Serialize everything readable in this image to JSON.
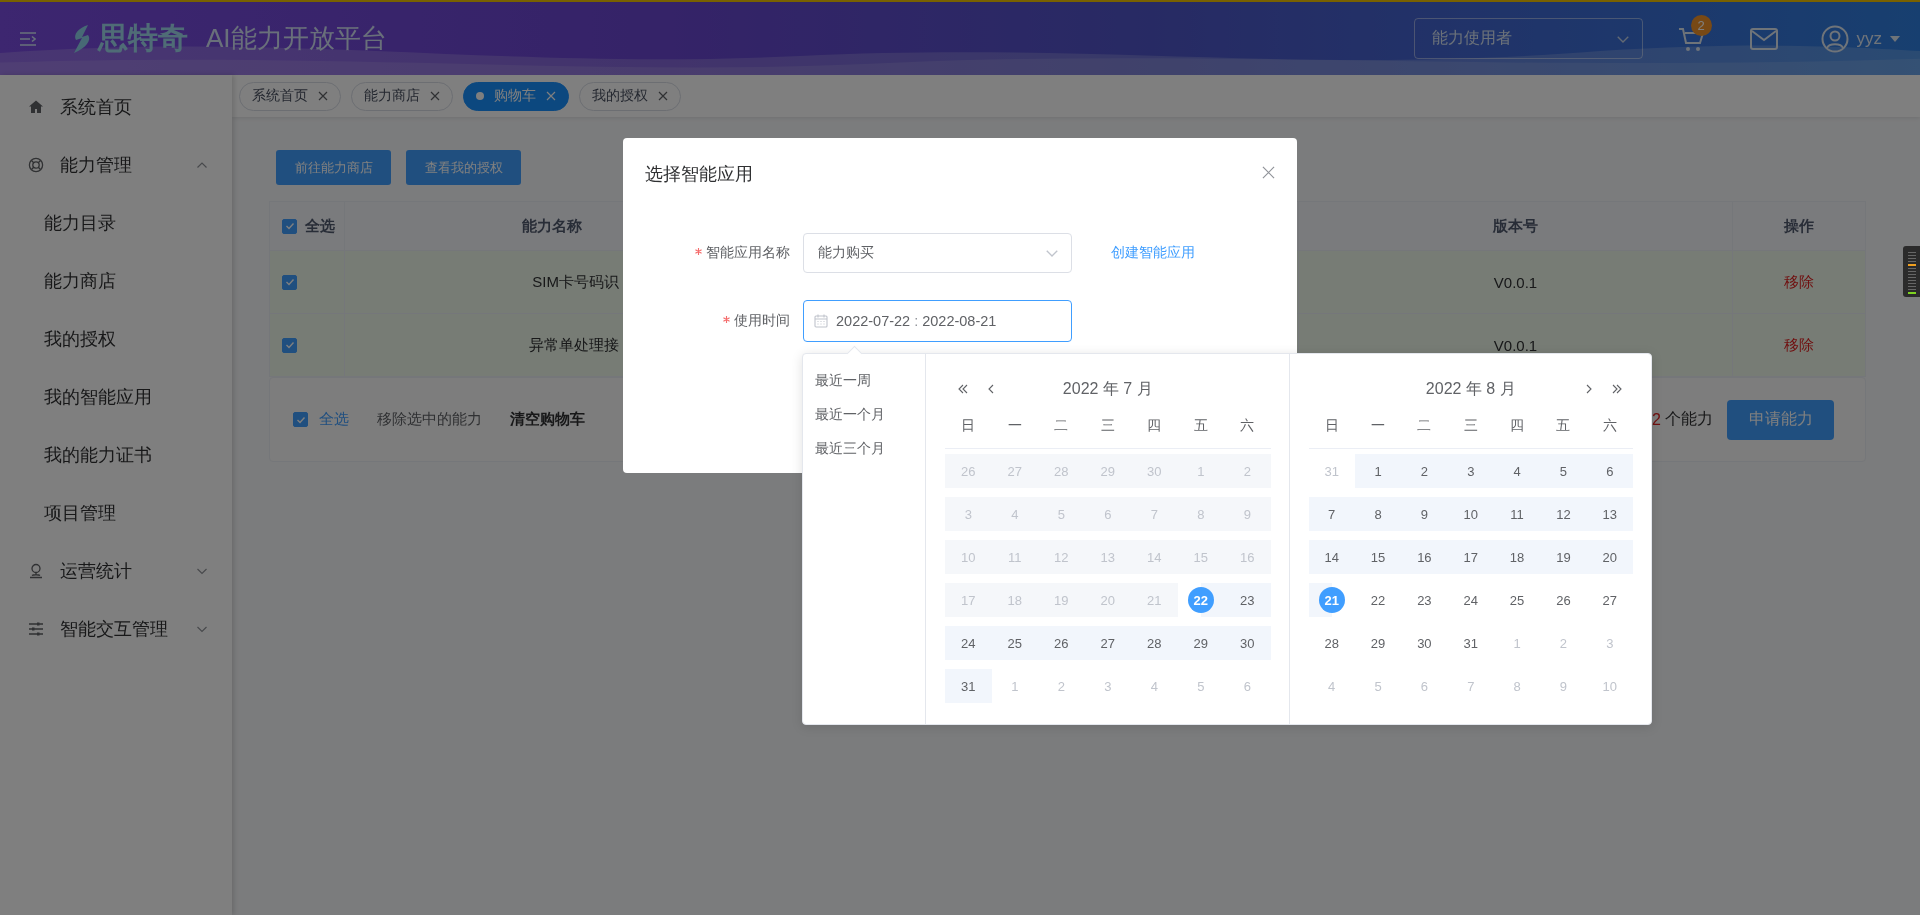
{
  "header": {
    "brand": "思特奇",
    "title": "AI能力开放平台",
    "role_select": "能力使用者",
    "cart_count": "2",
    "user": "yyz"
  },
  "sidebar": {
    "items": [
      {
        "label": "系统首页"
      },
      {
        "label": "能力管理",
        "expanded": true,
        "children": [
          {
            "label": "能力目录"
          },
          {
            "label": "能力商店"
          },
          {
            "label": "我的授权"
          },
          {
            "label": "我的智能应用"
          },
          {
            "label": "我的能力证书"
          },
          {
            "label": "项目管理"
          }
        ]
      },
      {
        "label": "运营统计",
        "expanded": false
      },
      {
        "label": "智能交互管理",
        "expanded": false
      }
    ]
  },
  "tabs": [
    {
      "label": "系统首页",
      "selected": false
    },
    {
      "label": "能力商店",
      "selected": false
    },
    {
      "label": "购物车",
      "selected": true
    },
    {
      "label": "我的授权",
      "selected": false
    }
  ],
  "toolbar_buttons": [
    "前往能力商店",
    "查看我的授权"
  ],
  "table": {
    "select_all": {
      "label": "全选",
      "checked": true
    },
    "columns": [
      "能力名称",
      "版本号",
      "操作"
    ],
    "rows": [
      {
        "checked": true,
        "name": "SIM卡号码识",
        "version": "V0.0.1",
        "action": "移除"
      },
      {
        "checked": true,
        "name": "异常单处理接",
        "version": "V0.0.1",
        "action": "移除"
      }
    ]
  },
  "footer": {
    "select_all": {
      "label": "全选",
      "checked": true
    },
    "remove_selected": "移除选中的能力",
    "clear_cart": "清空购物车",
    "count": "2",
    "count_label": "个能力",
    "apply_button": "申请能力"
  },
  "dialog": {
    "title": "选择智能应用",
    "fields": [
      {
        "kind": "select",
        "label": "智能应用名称",
        "required": true,
        "value": "能力购买",
        "link": "创建智能应用"
      },
      {
        "kind": "daterange",
        "label": "使用时间",
        "required": true,
        "focused": true,
        "start": "2022-07-22",
        "separator": ":",
        "end": "2022-08-21"
      }
    ]
  },
  "date_picker": {
    "shortcuts": [
      "最近一周",
      "最近一个月",
      "最近三个月"
    ],
    "panels": [
      {
        "title": "2022 年 7 月",
        "weekdays": [
          "日",
          "一",
          "二",
          "三",
          "四",
          "五",
          "六"
        ],
        "weeks": [
          [
            {
              "d": "26",
              "kind": "disabled"
            },
            {
              "d": "27",
              "kind": "disabled"
            },
            {
              "d": "28",
              "kind": "disabled"
            },
            {
              "d": "29",
              "kind": "disabled"
            },
            {
              "d": "30",
              "kind": "disabled"
            },
            {
              "d": "1",
              "kind": "disabled"
            },
            {
              "d": "2",
              "kind": "disabled"
            }
          ],
          [
            {
              "d": "3",
              "kind": "disabled"
            },
            {
              "d": "4",
              "kind": "disabled"
            },
            {
              "d": "5",
              "kind": "disabled"
            },
            {
              "d": "6",
              "kind": "disabled"
            },
            {
              "d": "7",
              "kind": "disabled"
            },
            {
              "d": "8",
              "kind": "disabled"
            },
            {
              "d": "9",
              "kind": "disabled"
            }
          ],
          [
            {
              "d": "10",
              "kind": "disabled"
            },
            {
              "d": "11",
              "kind": "disabled"
            },
            {
              "d": "12",
              "kind": "disabled"
            },
            {
              "d": "13",
              "kind": "disabled"
            },
            {
              "d": "14",
              "kind": "disabled"
            },
            {
              "d": "15",
              "kind": "disabled"
            },
            {
              "d": "16",
              "kind": "disabled"
            }
          ],
          [
            {
              "d": "17",
              "kind": "disabled"
            },
            {
              "d": "18",
              "kind": "disabled"
            },
            {
              "d": "19",
              "kind": "disabled"
            },
            {
              "d": "20",
              "kind": "disabled"
            },
            {
              "d": "21",
              "kind": "disabled"
            },
            {
              "d": "22",
              "kind": "start"
            },
            {
              "d": "23",
              "kind": "range"
            }
          ],
          [
            {
              "d": "24",
              "kind": "range"
            },
            {
              "d": "25",
              "kind": "range"
            },
            {
              "d": "26",
              "kind": "range"
            },
            {
              "d": "27",
              "kind": "range"
            },
            {
              "d": "28",
              "kind": "range"
            },
            {
              "d": "29",
              "kind": "range"
            },
            {
              "d": "30",
              "kind": "range"
            }
          ],
          [
            {
              "d": "31",
              "kind": "range"
            },
            {
              "d": "1",
              "kind": "outside"
            },
            {
              "d": "2",
              "kind": "outside"
            },
            {
              "d": "3",
              "kind": "outside"
            },
            {
              "d": "4",
              "kind": "outside"
            },
            {
              "d": "5",
              "kind": "outside"
            },
            {
              "d": "6",
              "kind": "outside"
            }
          ]
        ]
      },
      {
        "title": "2022 年 8 月",
        "weekdays": [
          "日",
          "一",
          "二",
          "三",
          "四",
          "五",
          "六"
        ],
        "weeks": [
          [
            {
              "d": "31",
              "kind": "outside"
            },
            {
              "d": "1",
              "kind": "range"
            },
            {
              "d": "2",
              "kind": "range"
            },
            {
              "d": "3",
              "kind": "range"
            },
            {
              "d": "4",
              "kind": "range"
            },
            {
              "d": "5",
              "kind": "range"
            },
            {
              "d": "6",
              "kind": "range"
            }
          ],
          [
            {
              "d": "7",
              "kind": "range"
            },
            {
              "d": "8",
              "kind": "range"
            },
            {
              "d": "9",
              "kind": "range"
            },
            {
              "d": "10",
              "kind": "range"
            },
            {
              "d": "11",
              "kind": "range"
            },
            {
              "d": "12",
              "kind": "range"
            },
            {
              "d": "13",
              "kind": "range"
            }
          ],
          [
            {
              "d": "14",
              "kind": "range"
            },
            {
              "d": "15",
              "kind": "range"
            },
            {
              "d": "16",
              "kind": "range"
            },
            {
              "d": "17",
              "kind": "range"
            },
            {
              "d": "18",
              "kind": "range"
            },
            {
              "d": "19",
              "kind": "range"
            },
            {
              "d": "20",
              "kind": "range"
            }
          ],
          [
            {
              "d": "21",
              "kind": "end"
            },
            {
              "d": "22",
              "kind": "plain"
            },
            {
              "d": "23",
              "kind": "plain"
            },
            {
              "d": "24",
              "kind": "plain"
            },
            {
              "d": "25",
              "kind": "plain"
            },
            {
              "d": "26",
              "kind": "plain"
            },
            {
              "d": "27",
              "kind": "plain"
            }
          ],
          [
            {
              "d": "28",
              "kind": "plain"
            },
            {
              "d": "29",
              "kind": "plain"
            },
            {
              "d": "30",
              "kind": "plain"
            },
            {
              "d": "31",
              "kind": "plain"
            },
            {
              "d": "1",
              "kind": "outside"
            },
            {
              "d": "2",
              "kind": "outside"
            },
            {
              "d": "3",
              "kind": "outside"
            }
          ],
          [
            {
              "d": "4",
              "kind": "outside"
            },
            {
              "d": "5",
              "kind": "outside"
            },
            {
              "d": "6",
              "kind": "outside"
            },
            {
              "d": "7",
              "kind": "outside"
            },
            {
              "d": "8",
              "kind": "outside"
            },
            {
              "d": "9",
              "kind": "outside"
            },
            {
              "d": "10",
              "kind": "outside"
            }
          ]
        ]
      }
    ]
  }
}
